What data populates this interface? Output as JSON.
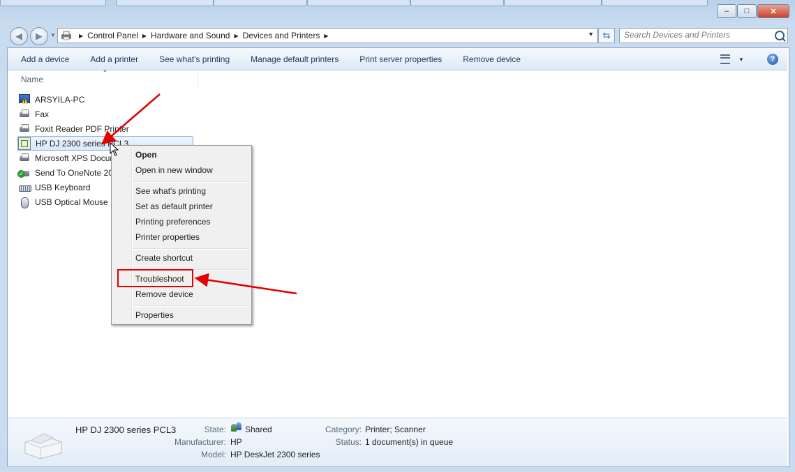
{
  "window": {
    "minimize_glyph": "–",
    "maximize_glyph": "□",
    "close_glyph": "✕"
  },
  "address": {
    "breadcrumbs": [
      "Control Panel",
      "Hardware and Sound",
      "Devices and Printers"
    ],
    "search_placeholder": "Search Devices and Printers"
  },
  "toolbar": {
    "items": [
      "Add a device",
      "Add a printer",
      "See what's printing",
      "Manage default printers",
      "Print server properties",
      "Remove device"
    ],
    "help_glyph": "?"
  },
  "list": {
    "column_header": "Name",
    "devices": [
      {
        "label": "ARSYILA-PC",
        "icon": "computer-warning-icon"
      },
      {
        "label": "Fax",
        "icon": "fax-icon"
      },
      {
        "label": "Foxit Reader PDF Printer",
        "icon": "printer-icon"
      },
      {
        "label": "HP DJ 2300 series PCL3",
        "icon": "hp-printer-icon",
        "selected": true
      },
      {
        "label": "Microsoft XPS Docum",
        "icon": "printer-icon"
      },
      {
        "label": "Send To OneNote 20",
        "icon": "default-printer-icon"
      },
      {
        "label": "USB Keyboard",
        "icon": "keyboard-icon"
      },
      {
        "label": "USB Optical Mouse",
        "icon": "mouse-icon"
      }
    ]
  },
  "context_menu": {
    "items": [
      {
        "label": "Open",
        "bold": true
      },
      {
        "label": "Open in new window"
      },
      {
        "label": "See what's printing"
      },
      {
        "label": "Set as default printer"
      },
      {
        "label": "Printing preferences"
      },
      {
        "label": "Printer properties"
      },
      {
        "label": "Create shortcut"
      },
      {
        "label": "Troubleshoot",
        "highlighted": true
      },
      {
        "label": "Remove device"
      },
      {
        "label": "Properties"
      }
    ]
  },
  "details": {
    "device_name": "HP DJ 2300 series PCL3",
    "state_label": "State:",
    "state_value": "Shared",
    "manufacturer_label": "Manufacturer:",
    "manufacturer_value": "HP",
    "model_label": "Model:",
    "model_value": "HP DeskJet 2300 series",
    "category_label": "Category:",
    "category_value": "Printer; Scanner",
    "status_label": "Status:",
    "status_value": "1 document(s) in queue"
  },
  "colors": {
    "annotation": "#e00000",
    "link_text": "#1e3b63",
    "selection": "#d9e8fb"
  }
}
